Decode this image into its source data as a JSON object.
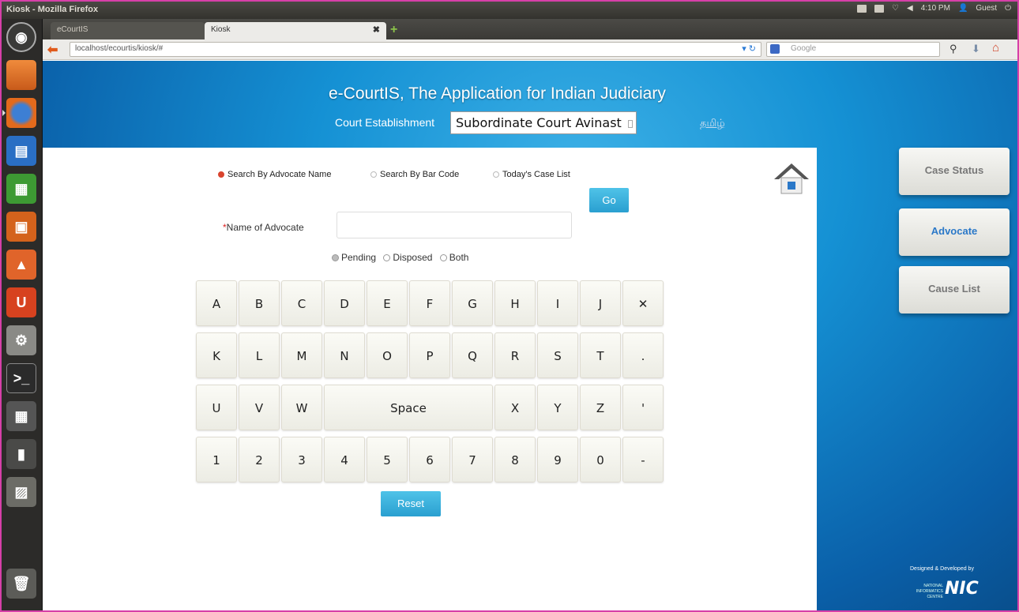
{
  "window": {
    "title": "Kiosk - Mozilla Firefox",
    "clock": "4:10 PM",
    "user": "Guest"
  },
  "tabs": [
    {
      "label": "eCourtIS"
    },
    {
      "label": "Kiosk"
    }
  ],
  "navbar": {
    "url": "localhost/ecourtis/kiosk/#",
    "search_placeholder": "Google"
  },
  "header": {
    "title": "e-CourtIS, The Application for Indian Judiciary",
    "court_label": "Court Establishment",
    "court_selected": "Subordinate Court Avinast",
    "language_link": "தமிழ்"
  },
  "search_options": {
    "advocate": "Search By Advocate Name",
    "barcode": "Search By Bar Code",
    "today": "Today's Case List"
  },
  "go_label": "Go",
  "advocate_field": {
    "required_mark": "*",
    "label": "Name of Advocate",
    "value": ""
  },
  "status_options": {
    "pending": "Pending",
    "disposed": "Disposed",
    "both": "Both"
  },
  "keyboard": {
    "row1": [
      "A",
      "B",
      "C",
      "D",
      "E",
      "F",
      "G",
      "H",
      "I",
      "J"
    ],
    "row2": [
      "K",
      "L",
      "M",
      "N",
      "O",
      "P",
      "Q",
      "R",
      "S",
      "T",
      "."
    ],
    "row3_left": [
      "U",
      "V",
      "W"
    ],
    "space": "Space",
    "row3_right": [
      "X",
      "Y",
      "Z",
      "'"
    ],
    "row4": [
      "1",
      "2",
      "3",
      "4",
      "5",
      "6",
      "7",
      "8",
      "9",
      "0",
      "-"
    ]
  },
  "reset_label": "Reset",
  "side_menu": {
    "case_status": "Case Status",
    "advocate": "Advocate",
    "cause_list": "Cause List"
  },
  "credit": {
    "text": "Designed & Developed by",
    "logo": "NIC",
    "org": "NATIONAL INFORMATICS CENTRE"
  },
  "colors": {
    "accent": "#2a9fd0",
    "selected_radio": "#d9442e",
    "background": "#1591d4"
  }
}
